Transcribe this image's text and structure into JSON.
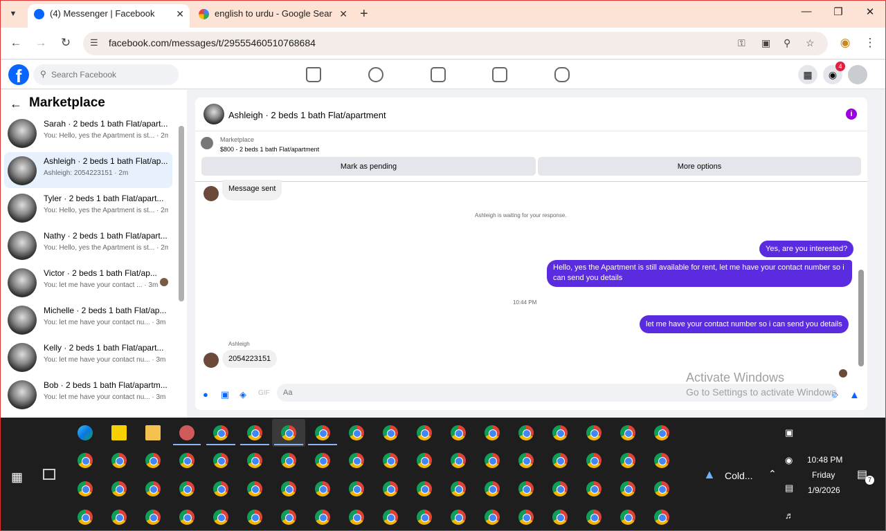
{
  "browser": {
    "tabs": [
      {
        "title": "(4) Messenger | Facebook",
        "favicon": "facebook-favicon",
        "active": true
      },
      {
        "title": "english to urdu - Google Search",
        "favicon": "google-favicon",
        "active": false
      }
    ],
    "url": "facebook.com/messages/t/29555460510768684",
    "chrome_color": "#fde3d5"
  },
  "facebook": {
    "search_placeholder": "Search Facebook",
    "notification_count": "4",
    "brand_color": "#0866ff"
  },
  "sidebar": {
    "heading": "Marketplace",
    "conversations": [
      {
        "name": "Sarah · 2 beds 1 bath Flat/apart...",
        "preview": "You: Hello, yes the Apartment is st... · 2m",
        "selected": false
      },
      {
        "name": "Ashleigh · 2 beds 1 bath Flat/ap...",
        "preview": "Ashleigh: 2054223151 · 2m",
        "selected": true
      },
      {
        "name": "Tyler · 2 beds 1 bath Flat/apart...",
        "preview": "You: Hello, yes the Apartment is st... · 2m",
        "selected": false
      },
      {
        "name": "Nathy · 2 beds 1 bath Flat/apart...",
        "preview": "You: Hello, yes the Apartment is st... · 2m",
        "selected": false
      },
      {
        "name": "Victor · 2 beds 1 bath Flat/ap...",
        "preview": "You: let me have your contact ... · 3m",
        "selected": false
      },
      {
        "name": "Michelle · 2 beds 1 bath Flat/ap...",
        "preview": "You: let me have your contact nu... · 3m",
        "selected": false
      },
      {
        "name": "Kelly · 2 beds 1 bath Flat/apart...",
        "preview": "You: let me have your contact nu... · 3m",
        "selected": false
      },
      {
        "name": "Bob · 2 beds 1 bath Flat/apartm...",
        "preview": "You: let me have your contact nu... · 3m",
        "selected": false
      }
    ]
  },
  "chat": {
    "header_title": "Ashleigh · 2 beds 1 bath Flat/apartment",
    "marketplace_label": "Marketplace",
    "listing": "$800 - 2 beds 1 bath Flat/apartment",
    "mark_pending_label": "Mark as pending",
    "more_options_label": "More options",
    "messages": {
      "message_sent": "Message sent",
      "waiting_note": "Ashleigh is waiting for your response.",
      "out1": "Yes, are you interested?",
      "out2": "Hello, yes the Apartment is still available for rent, let me have your contact number so i can send you details",
      "timestamp": "10:44 PM",
      "out3": "let me have your contact number so i can send you details",
      "sender_name": "Ashleigh",
      "in_number": "2054223151"
    },
    "composer_placeholder": "Aa",
    "accent_color": "#5b2be0"
  },
  "watermark": {
    "line1": "Activate Windows",
    "line2": "Go to Settings to activate Windows."
  },
  "taskbar": {
    "weather": "Cold...",
    "time": "10:48 PM",
    "day": "Friday",
    "date": "1/9/2026",
    "notifications_count": "7"
  }
}
